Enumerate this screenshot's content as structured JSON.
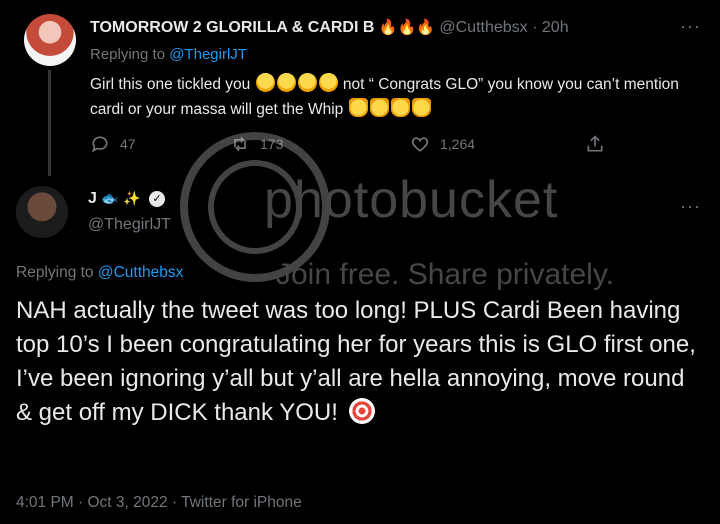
{
  "reply": {
    "display_name": "TOMORROW 2 GLORILLA & CARDI B",
    "fire_emojis": "🔥🔥🔥",
    "handle": "@Cutthebsx",
    "separator": "·",
    "time": "20h",
    "replying_prefix": "Replying to ",
    "replying_to": "@ThegirlJT",
    "text_part1": "Girl this one tickled you",
    "text_part2": "not “ Congrats GLO” you know you can’t mention cardi or your massa will get the Whip",
    "stats": {
      "replies": "47",
      "retweets": "173",
      "likes": "1,264"
    }
  },
  "main": {
    "display_name": "J",
    "handle": "@ThegirlJT",
    "replying_prefix": "Replying to ",
    "replying_to": "@Cutthebsx",
    "text": "NAH actually the tweet was too long! PLUS Cardi Been having top 10’s I been congratulating her for years this is GLO first one, I’ve been ignoring y’all but y’all are hella annoying, move round & get off my DICK thank YOU!",
    "timestamp": "4:01 PM · Oct 3, 2022 · Twitter for iPhone"
  },
  "watermark": {
    "brand": "photobucket",
    "tagline": "Join free. Share privately."
  },
  "icons": {
    "reply": "reply-icon",
    "retweet": "retweet-icon",
    "like": "like-icon",
    "share": "share-icon",
    "more": "more-icon",
    "verified": "verified-badge-icon"
  },
  "colors": {
    "background": "#000000",
    "text": "#e7e9ea",
    "muted": "#71767b",
    "link": "#1d9bf0"
  }
}
